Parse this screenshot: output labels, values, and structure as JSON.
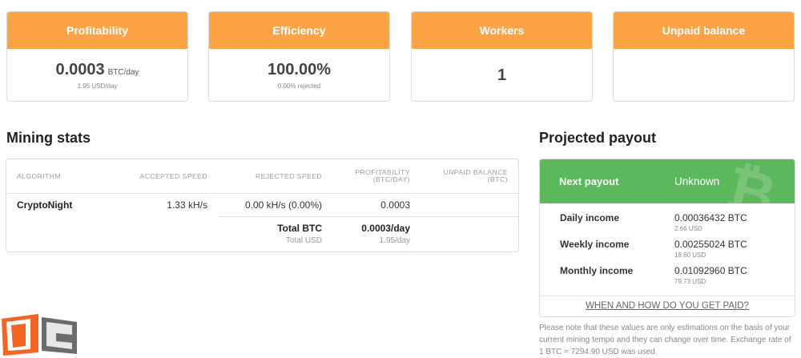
{
  "cards": {
    "profitability": {
      "title": "Profitability",
      "value": "0.0003",
      "unit": "BTC/day",
      "sub": "1.95 USD/day"
    },
    "efficiency": {
      "title": "Efficiency",
      "value": "100.00%",
      "sub": "0.00% rejected"
    },
    "workers": {
      "title": "Workers",
      "value": "1"
    },
    "unpaid": {
      "title": "Unpaid balance"
    }
  },
  "mining": {
    "title": "Mining stats",
    "headers": {
      "algorithm": "ALGORITHM",
      "accepted": "ACCEPTED SPEED",
      "rejected": "REJECTED SPEED",
      "profit_1": "PROFITABILITY",
      "profit_2": "(BTC/DAY)",
      "unpaid_1": "UNPAID BALANCE",
      "unpaid_2": "(BTC)"
    },
    "row": {
      "algorithm": "CryptoNight",
      "accepted": "1.33 kH/s",
      "rejected": "0.00 kH/s (0.00%)",
      "profitability": "0.0003"
    },
    "totals": {
      "btc_label": "Total BTC",
      "btc_value": "0.0003/day",
      "usd_label": "Total USD",
      "usd_value": "1.95/day"
    }
  },
  "payout": {
    "title": "Projected payout",
    "next_label": "Next payout",
    "next_value": "Unknown",
    "bitcoin_glyph": "₿",
    "daily": {
      "label": "Daily income",
      "btc": "0.00036432 BTC",
      "usd": "2.66 USD"
    },
    "weekly": {
      "label": "Weekly income",
      "btc": "0.00255024 BTC",
      "usd": "18.60 USD"
    },
    "monthly": {
      "label": "Monthly income",
      "btc": "0.01092960 BTC",
      "usd": "79.73 USD"
    },
    "link": "WHEN AND HOW DO YOU GET PAID?",
    "note": "Please note that these values are only estimations on the basis of your current mining tempo and they can change over time. Exchange rate of 1 BTC = 7294.90 USD was used."
  },
  "colors": {
    "orange": "#fca346",
    "green": "#5cb85c",
    "logo_orange": "#f26522"
  }
}
